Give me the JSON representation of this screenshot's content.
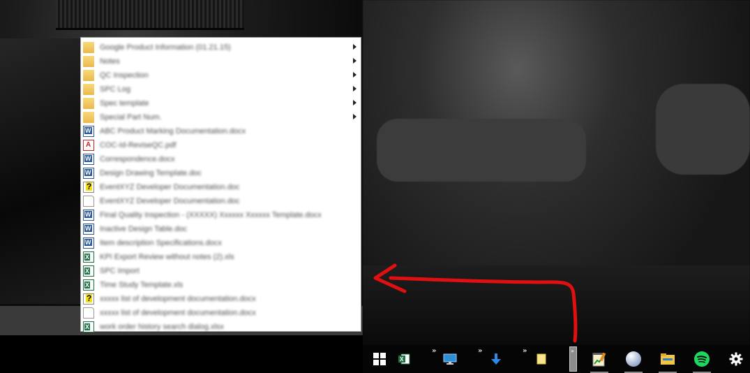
{
  "jumplist": {
    "items": [
      {
        "type": "folder",
        "label": "Google Product Information (01.21.15)",
        "submenu": true
      },
      {
        "type": "folder",
        "label": "Notes",
        "submenu": true
      },
      {
        "type": "folder",
        "label": "QC Inspection",
        "submenu": true
      },
      {
        "type": "folder",
        "label": "SPC Log",
        "submenu": true
      },
      {
        "type": "folder",
        "label": "Spec template",
        "submenu": true
      },
      {
        "type": "folder",
        "label": "Special Part Num.",
        "submenu": true
      },
      {
        "type": "word",
        "label": "ABC Product Marking Documentation.docx",
        "submenu": false
      },
      {
        "type": "pdf",
        "label": "COC-Id-ReviseQC.pdf",
        "submenu": false
      },
      {
        "type": "word",
        "label": "Correspondence.docx",
        "submenu": false
      },
      {
        "type": "word",
        "label": "Design Drawing Template.doc",
        "submenu": false
      },
      {
        "type": "unknown",
        "label": "EventXYZ Developer Documentation.doc",
        "submenu": false
      },
      {
        "type": "blank",
        "label": "EventXYZ Developer Documentation.doc",
        "submenu": false
      },
      {
        "type": "word",
        "label": "Final Quality Inspection - (XXXXX) Xxxxxx Xxxxxx Template.docx",
        "submenu": false
      },
      {
        "type": "word",
        "label": "Inactive Design Table.doc",
        "submenu": false
      },
      {
        "type": "word",
        "label": "Item description Specifications.docx",
        "submenu": false
      },
      {
        "type": "excel",
        "label": "KPI Export Review without notes (2).xls",
        "submenu": false
      },
      {
        "type": "excel",
        "label": "SPC Import",
        "submenu": false
      },
      {
        "type": "excel",
        "label": "Time Study Template.xls",
        "submenu": false
      },
      {
        "type": "unknown",
        "label": "xxxxx list of development documentation.docx",
        "submenu": false
      },
      {
        "type": "blank",
        "label": "xxxxx list of development documentation.docx",
        "submenu": false
      },
      {
        "type": "excel",
        "label": "work order history search dialog.xlsx",
        "submenu": false
      }
    ]
  },
  "taskbar": {
    "items": [
      {
        "name": "start-windows-icon"
      },
      {
        "name": "excel-icon"
      },
      {
        "name": "desktop-monitor-icon"
      },
      {
        "name": "download-arrow-icon"
      },
      {
        "name": "sticky-note-icon"
      },
      {
        "name": "taskbar-overflow-chevron-icon"
      },
      {
        "name": "notepad-chart-icon"
      },
      {
        "name": "globe-sphere-icon"
      },
      {
        "name": "file-explorer-icon"
      },
      {
        "name": "spotify-icon"
      },
      {
        "name": "settings-gear-icon"
      }
    ],
    "overflow_label": "»"
  },
  "annotation": {
    "color": "#e01010"
  }
}
